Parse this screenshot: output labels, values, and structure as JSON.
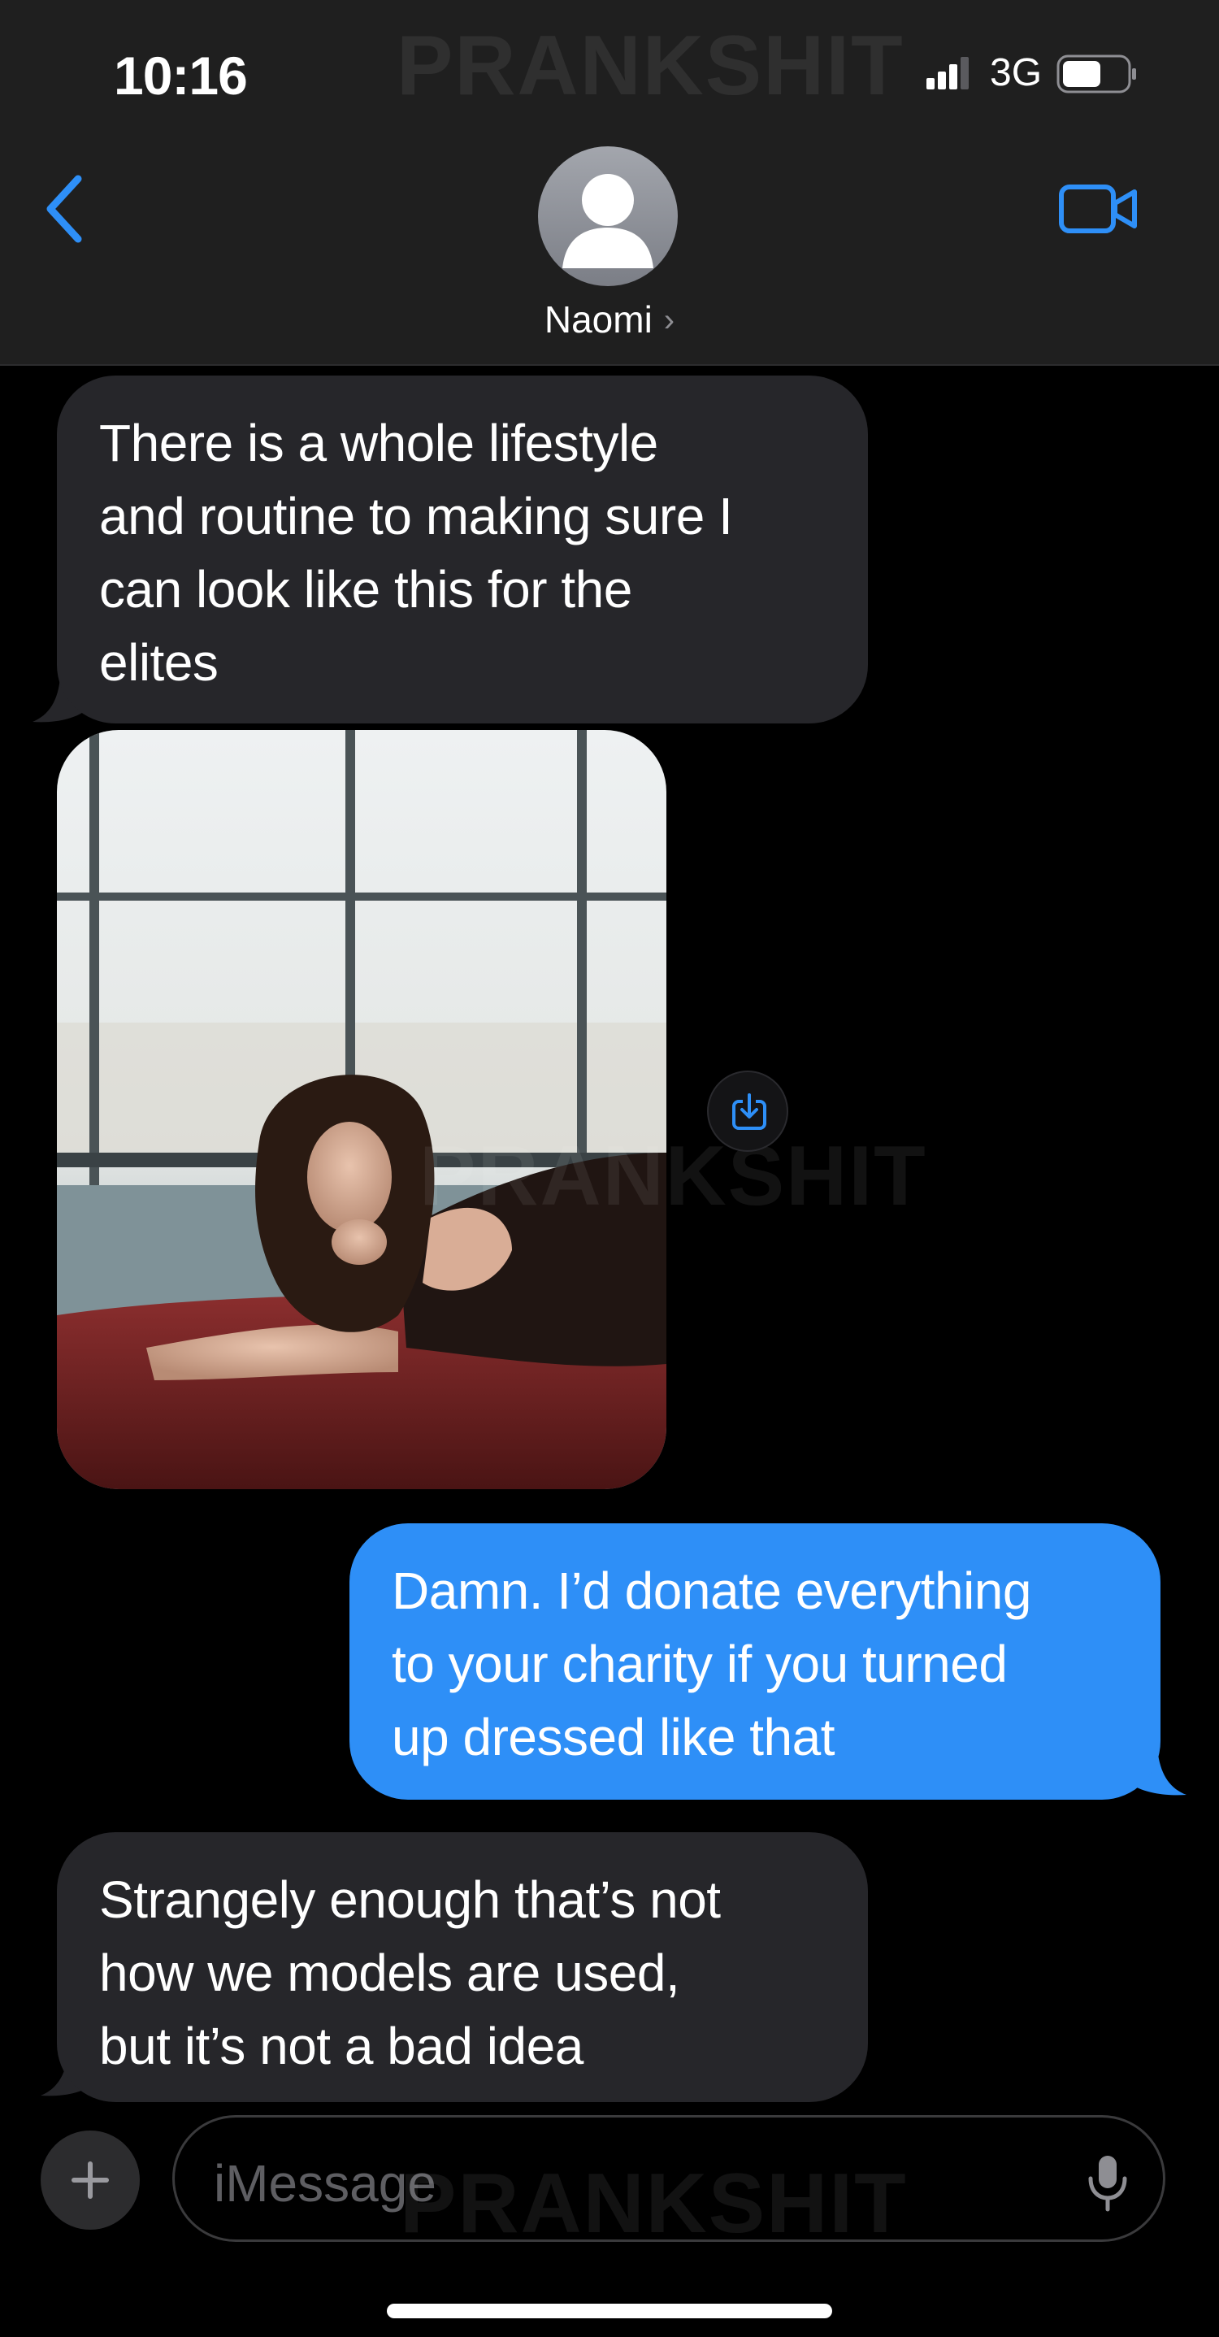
{
  "status_bar": {
    "time": "10:16",
    "network": "3G",
    "icons": [
      "signal-bars-icon",
      "battery-icon"
    ]
  },
  "watermark": "PRANKSHIT",
  "header": {
    "contact_name": "Naomi",
    "icons": [
      "chevron-left-icon",
      "person-avatar-icon",
      "chevron-right-icon",
      "video-camera-icon"
    ]
  },
  "messages": [
    {
      "direction": "incoming",
      "lines": [
        "There is a whole lifestyle",
        "and routine to making sure I",
        "can look like this for the",
        "elites"
      ]
    },
    {
      "direction": "incoming",
      "type": "photo"
    },
    {
      "direction": "outgoing",
      "lines": [
        "Damn. I’d donate everything",
        "to your charity if you turned",
        "up dressed like that"
      ]
    },
    {
      "direction": "incoming",
      "lines": [
        "Strangely enough that’s not",
        "how we models are used,",
        "but it’s not a bad idea"
      ]
    }
  ],
  "input_bar": {
    "placeholder": "iMessage",
    "icons": [
      "plus-icon",
      "microphone-icon"
    ]
  },
  "colors": {
    "background": "#000000",
    "header": "#1f1f1f",
    "incoming_bubble": "#26262a",
    "outgoing_bubble": "#2e8ff7",
    "accent": "#2e8ff7"
  }
}
